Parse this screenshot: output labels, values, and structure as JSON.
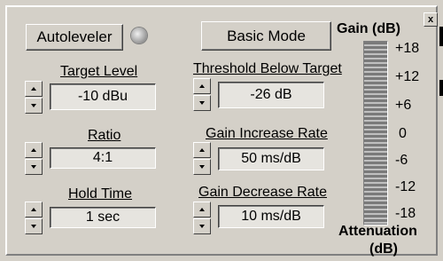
{
  "buttons": {
    "autoleveler": "Autoleveler",
    "basic_mode": "Basic Mode"
  },
  "controls": {
    "target_level": {
      "label": "Target Level",
      "value": "-10 dBu"
    },
    "ratio": {
      "label": "Ratio",
      "value": "4:1"
    },
    "hold_time": {
      "label": "Hold Time",
      "value": "1 sec"
    },
    "threshold": {
      "label": "Threshold Below Target",
      "value": "-26 dB"
    },
    "gain_increase": {
      "label": "Gain Increase Rate",
      "value": "50 ms/dB"
    },
    "gain_decrease": {
      "label": "Gain Decrease Rate",
      "value": "10 ms/dB"
    }
  },
  "meter": {
    "title": "Gain (dB)",
    "ticks": [
      "+18",
      "+12",
      "+6",
      "0",
      "-6",
      "-12",
      "-18"
    ],
    "footer_line1": "Attenuation",
    "footer_line2": "(dB)"
  },
  "close_label": "x"
}
